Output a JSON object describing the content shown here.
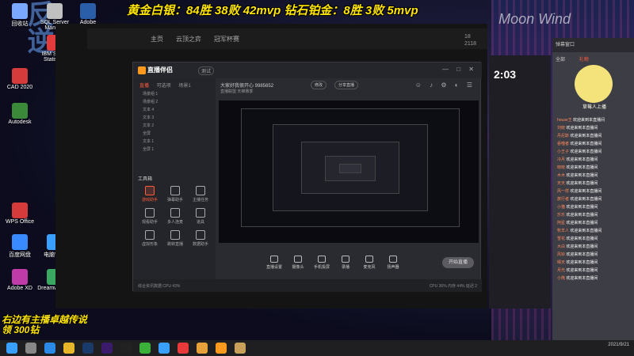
{
  "banners": {
    "top": "黄金白银：84胜 38败 42mvp 钻石铂金：8胜 3败 5mvp",
    "bottom_line1": "右边有主播卓越传说",
    "bottom_line2": "领 300钻"
  },
  "wallpaper": {
    "brand": "Moon Wind",
    "side_text": "反逆"
  },
  "desktop_icons": [
    {
      "label": "回收站",
      "color": "#7aa7ff"
    },
    {
      "label": "SQL Server Manage",
      "color": "#c0c0c0"
    },
    {
      "label": "Adobe",
      "color": "#2b5ea8"
    },
    {
      "label": "IBM SPSS Statistics",
      "color": "#e23b3b"
    },
    {
      "label": "CAD 2020",
      "color": "#d63b3b"
    },
    {
      "label": "Autodesk",
      "color": "#3a8a3a"
    },
    {
      "label": "WPS Office",
      "color": "#d63b3b"
    },
    {
      "label": "百度网盘",
      "color": "#3a8aff"
    },
    {
      "label": "电脑管家",
      "color": "#3aa0ff"
    },
    {
      "label": "Adobe XD",
      "color": "#c03aa8"
    },
    {
      "label": "Dreamweaver",
      "color": "#3aa860"
    }
  ],
  "browser": {
    "nav": [
      "主页",
      "云顶之弈",
      "冠军杯赛"
    ],
    "stats": [
      "18",
      "2118"
    ]
  },
  "app": {
    "logo": "直播伴侣",
    "version": "测试",
    "window_buttons": "— □ ✕",
    "side_tabs": [
      "直播",
      "可选项",
      "场景1"
    ],
    "scenes": [
      "场景组 1",
      "场景组 2",
      "文本 4",
      "文本 3",
      "文本 2",
      "全屏",
      "文本 1",
      "全屏 1"
    ],
    "tools_title": "工具箱",
    "tools": [
      "游戏助手",
      "弹幕助手",
      "主播任务",
      "观看助手",
      "多人连麦",
      "道具",
      "虚拟形象",
      "跳转直播",
      "数据助手"
    ],
    "room_title": "大家好我很开心 9985652",
    "room_tag": "直播联盟  天梯赛季",
    "edit_btn": "修改",
    "share_btn": "分享直播",
    "head_icons": "☺ ♪ ⚙ ◐ ☰",
    "bottom_tools": [
      "直播设置",
      "摄像头",
      "手机投屏",
      "录播",
      "麦克风",
      "扬声器"
    ],
    "live_button": "开始直播",
    "status_left": "综合资讯数据:CPU 43%",
    "status_right": "CPU 36% 内存 44% 延迟 2"
  },
  "chat": {
    "header": "弹幕窗口",
    "tabs": [
      "全部",
      "礼物"
    ],
    "mascot_text": "草莓人上播",
    "lines": [
      {
        "user": "house王",
        "text": "欢迎来到本直播间"
      },
      {
        "user": "刘晓",
        "text": "欢迎来到本直播间"
      },
      {
        "user": "丹尼斯",
        "text": "欢迎来到本直播间"
      },
      {
        "user": "吞噬者",
        "text": "欢迎来到本直播间"
      },
      {
        "user": "小王子",
        "text": "欢迎来到本直播间"
      },
      {
        "user": "冷月",
        "text": "欢迎来到本直播间"
      },
      {
        "user": "晓晓",
        "text": "欢迎来到本直播间"
      },
      {
        "user": "木木",
        "text": "欢迎来到本直播间"
      },
      {
        "user": "天天",
        "text": "欢迎来到本直播间"
      },
      {
        "user": "风一样",
        "text": "欢迎来到本直播间"
      },
      {
        "user": "旅行者",
        "text": "欢迎来到本直播间"
      },
      {
        "user": "小猫",
        "text": "欢迎来到本直播间"
      },
      {
        "user": "乐乐",
        "text": "欢迎来到本直播间"
      },
      {
        "user": "阿星",
        "text": "欢迎来到本直播间"
      },
      {
        "user": "牧羊人",
        "text": "欢迎来到本直播间"
      },
      {
        "user": "雪花",
        "text": "欢迎来到本直播间"
      },
      {
        "user": "大白",
        "text": "欢迎来到本直播间"
      },
      {
        "user": "风铃",
        "text": "欢迎来到本直播间"
      },
      {
        "user": "晴天",
        "text": "欢迎来到本直播间"
      },
      {
        "user": "月光",
        "text": "欢迎来到本直播间"
      },
      {
        "user": "小熊",
        "text": "欢迎来到本直播间"
      }
    ]
  },
  "game": {
    "timer": "2:03"
  },
  "taskbar": {
    "time": "",
    "date": "2021/9/21",
    "apps": [
      {
        "name": "start",
        "color": "#3aa0ff"
      },
      {
        "name": "search",
        "color": "#888"
      },
      {
        "name": "edge",
        "color": "#2b8ae8"
      },
      {
        "name": "chrome",
        "color": "#e8b62b"
      },
      {
        "name": "ps",
        "color": "#1a3a6a"
      },
      {
        "name": "pr",
        "color": "#3a1a6a"
      },
      {
        "name": "capcut",
        "color": "#222"
      },
      {
        "name": "wechat",
        "color": "#3ab03a"
      },
      {
        "name": "qq",
        "color": "#3aa0ff"
      },
      {
        "name": "music",
        "color": "#e83a3a"
      },
      {
        "name": "browser",
        "color": "#e8a03a"
      },
      {
        "name": "live",
        "color": "#ff9a1f"
      },
      {
        "name": "lol",
        "color": "#c8a05a"
      }
    ]
  }
}
